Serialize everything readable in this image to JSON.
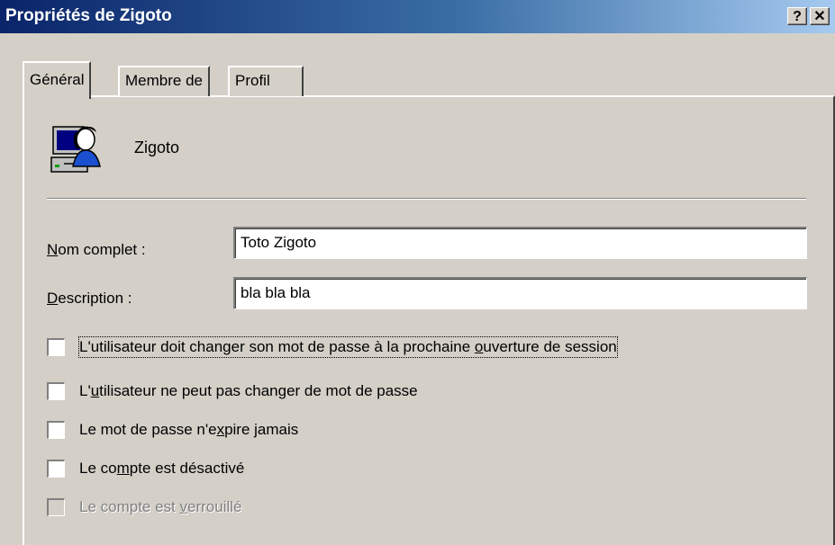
{
  "window": {
    "title": "Propriétés de Zigoto",
    "help_label": "?",
    "close_label": "✕"
  },
  "tabs": [
    {
      "label": "Général",
      "selected": true
    },
    {
      "label": "Membre de",
      "selected": false
    },
    {
      "label": "Profil",
      "selected": false
    }
  ],
  "user": {
    "name": "Zigoto",
    "icon": "user-computer-icon"
  },
  "fields": {
    "full_name": {
      "label_prefix": "",
      "label_access": "N",
      "label_rest": "om complet :",
      "value": "Toto Zigoto"
    },
    "description": {
      "label_prefix": "",
      "label_access": "D",
      "label_rest": "escription :",
      "value": "bla bla bla"
    }
  },
  "checkboxes": [
    {
      "pre": "L'utilisateur doit changer son mot de passe à la prochaine ",
      "access": "o",
      "post": "uverture de session",
      "checked": false,
      "enabled": true,
      "focused": true
    },
    {
      "pre": "L'",
      "access": "u",
      "post": "tilisateur ne peut pas changer de mot de passe",
      "checked": false,
      "enabled": true,
      "focused": false
    },
    {
      "pre": "Le mot de passe n'e",
      "access": "x",
      "post": "pire jamais",
      "checked": false,
      "enabled": true,
      "focused": false
    },
    {
      "pre": "Le co",
      "access": "m",
      "post": "pte est désactivé",
      "checked": false,
      "enabled": true,
      "focused": false
    },
    {
      "pre": "Le compte est ",
      "access": "v",
      "post": "errouillé",
      "checked": false,
      "enabled": false,
      "focused": false
    }
  ],
  "colors": {
    "titlebar_start": "#0a246a",
    "titlebar_end": "#a6caf0",
    "face": "#d4d0c8"
  }
}
